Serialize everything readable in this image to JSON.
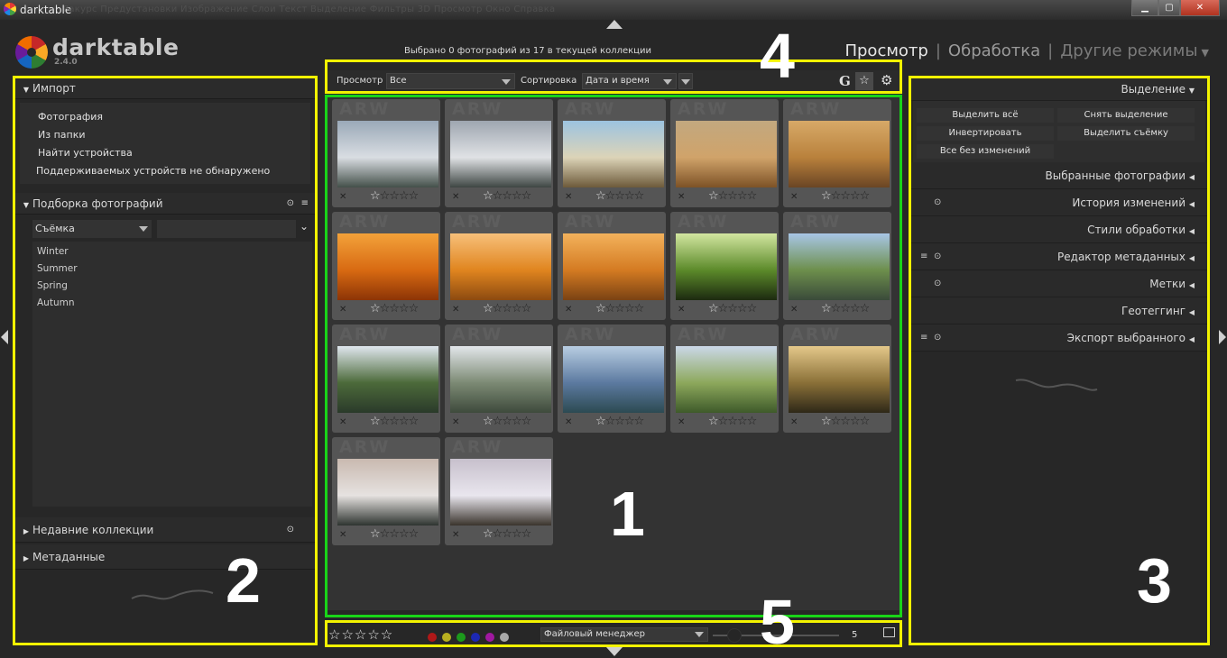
{
  "window": {
    "title": "darktable",
    "menu_text": "Ракурс   Предустановки   Изображение   Слои   Текст   Выделение   Фильтры   3D   Просмотр   Окно   Справка",
    "minimize": "▁",
    "maximize": "▢",
    "close": "✕"
  },
  "app": {
    "name": "darktable",
    "version": "2.4.0"
  },
  "status_text": "Выбрано 0 фотографий из 17 в текущей коллекции",
  "views": {
    "lighttable": "Просмотр",
    "darkroom": "Обработка",
    "other": "Другие режимы",
    "separator": "|"
  },
  "left_panel": {
    "import": {
      "title": "Импорт",
      "buttons": [
        "Фотография",
        "Из папки",
        "Найти устройства"
      ],
      "note": "Поддерживаемых устройств не обнаружено"
    },
    "collect": {
      "title": "Подборка фотографий",
      "property": "Съёмка",
      "items": [
        "Winter",
        "Summer",
        "Spring",
        "Autumn"
      ]
    },
    "recent": {
      "title": "Недавние коллекции"
    },
    "metadata": {
      "title": "Метаданные"
    }
  },
  "toolbar": {
    "view_label": "Просмотр",
    "view_value": "Все",
    "sort_label": "Сортировка",
    "sort_value": "Дата и время",
    "grouping_icon": "G"
  },
  "thumbnails": {
    "watermark": "ARW",
    "reject": "✕",
    "first_star": "☆",
    "other_stars": "☆☆☆☆",
    "items": [
      {
        "scene": "winter-forest-bench",
        "colors": [
          "#9aa9b8",
          "#d9dde2",
          "#44504a"
        ]
      },
      {
        "scene": "winter-bridge",
        "colors": [
          "#9ea6b0",
          "#e0e2e5",
          "#3e4643"
        ]
      },
      {
        "scene": "autumn-trees-field",
        "colors": [
          "#9cc3e0",
          "#dcd4b8",
          "#6d5a3a"
        ]
      },
      {
        "scene": "haystacks-field",
        "colors": [
          "#c2a87f",
          "#d0a36a",
          "#7d5226"
        ]
      },
      {
        "scene": "autumn-road-field",
        "colors": [
          "#d7a968",
          "#b9813c",
          "#6a4524"
        ]
      },
      {
        "scene": "orange-leaves-closeup",
        "colors": [
          "#f3a23a",
          "#d86a12",
          "#8c3406"
        ]
      },
      {
        "scene": "autumn-birch-forest",
        "colors": [
          "#f7c07a",
          "#e0851f",
          "#8c4a10"
        ]
      },
      {
        "scene": "autumn-forest-path",
        "colors": [
          "#f3b25c",
          "#d47b22",
          "#7a4213"
        ]
      },
      {
        "scene": "green-forest",
        "colors": [
          "#d2e6a0",
          "#5c8a2a",
          "#1c2a10"
        ]
      },
      {
        "scene": "lake-with-stones",
        "colors": [
          "#a8c6e6",
          "#6d8f4c",
          "#3a4a3a"
        ]
      },
      {
        "scene": "swamp-sunset",
        "colors": [
          "#dfe6ee",
          "#4c6a3a",
          "#2a3a2a"
        ]
      },
      {
        "scene": "lake-with-log",
        "colors": [
          "#e2e6ea",
          "#7c8a74",
          "#3e4a3c"
        ]
      },
      {
        "scene": "mountain-lake",
        "colors": [
          "#b8cde2",
          "#5c7aa0",
          "#2c4a52"
        ]
      },
      {
        "scene": "green-field-clouds",
        "colors": [
          "#cbd8e8",
          "#8da85c",
          "#3e5a2a"
        ]
      },
      {
        "scene": "tree-sunset",
        "colors": [
          "#e4c88a",
          "#8a7038",
          "#2e2818"
        ]
      },
      {
        "scene": "snowy-pines",
        "colors": [
          "#c9b9b0",
          "#e6e2e0",
          "#2e3430"
        ]
      },
      {
        "scene": "snowy-fence-path",
        "colors": [
          "#c7c0cc",
          "#e9e6ee",
          "#3a342c"
        ]
      }
    ]
  },
  "right_panel": {
    "select": {
      "title": "Выделение",
      "buttons": [
        "Выделить всё",
        "Снять выделение",
        "Инвертировать",
        "Выделить съёмку",
        "Все без изменений"
      ]
    },
    "sections": [
      "Выбранные фотографии",
      "История изменений",
      "Стили обработки",
      "Редактор метаданных",
      "Метки",
      "Геотеггинг",
      "Экспорт выбранного"
    ]
  },
  "bottom_bar": {
    "stars": "☆☆☆☆☆",
    "color_labels": [
      "#b01818",
      "#b8b020",
      "#1c9a1c",
      "#1c28b4",
      "#a018a0",
      "#a8a8a8"
    ],
    "import_target": "Файловый менеджер",
    "zoom_value": "5"
  },
  "annotations": {
    "n1": "1",
    "n2": "2",
    "n3": "3",
    "n4": "4",
    "n5": "5"
  }
}
